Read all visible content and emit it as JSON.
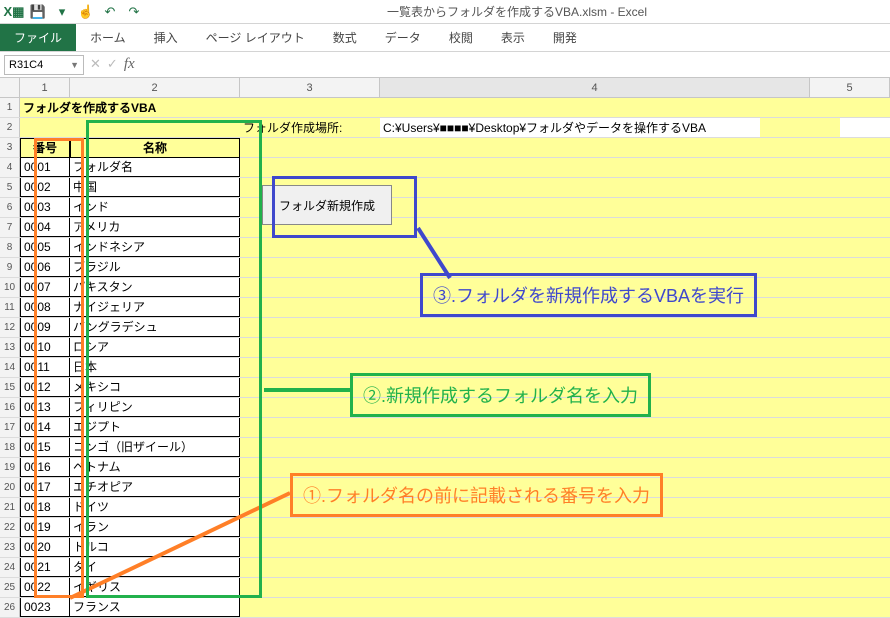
{
  "title": "一覧表からフォルダを作成するVBA.xlsm - Excel",
  "qat": {
    "excel": "X▦",
    "save": "💾",
    "dropdown": "▾",
    "touch": "☝",
    "undo": "↶",
    "redo": "↷"
  },
  "tabs": {
    "file": "ファイル",
    "home": "ホーム",
    "insert": "挿入",
    "pagelayout": "ページ レイアウト",
    "formulas": "数式",
    "data": "データ",
    "review": "校閲",
    "view": "表示",
    "developer": "開発"
  },
  "namebox": "R31C4",
  "fx_label": "fx",
  "columns": [
    "1",
    "2",
    "3",
    "4",
    "5"
  ],
  "sheet": {
    "title_cell": "フォルダを作成するVBA",
    "location_label": "フォルダ作成場所:",
    "location_value": "C:¥Users¥■■■■¥Desktop¥フォルダやデータを操作するVBA",
    "header": {
      "no": "番号",
      "name": "名称"
    },
    "rows": [
      {
        "no": "0001",
        "name": "フォルダ名"
      },
      {
        "no": "0002",
        "name": "中国"
      },
      {
        "no": "0003",
        "name": "インド"
      },
      {
        "no": "0004",
        "name": "アメリカ"
      },
      {
        "no": "0005",
        "name": "インドネシア"
      },
      {
        "no": "0006",
        "name": "ブラジル"
      },
      {
        "no": "0007",
        "name": "パキスタン"
      },
      {
        "no": "0008",
        "name": "ナイジェリア"
      },
      {
        "no": "0009",
        "name": "バングラデシュ"
      },
      {
        "no": "0010",
        "name": "ロシア"
      },
      {
        "no": "0011",
        "name": "日本"
      },
      {
        "no": "0012",
        "name": "メキシコ"
      },
      {
        "no": "0013",
        "name": "フィリピン"
      },
      {
        "no": "0014",
        "name": "エジプト"
      },
      {
        "no": "0015",
        "name": "コンゴ（旧ザイール）"
      },
      {
        "no": "0016",
        "name": "ベトナム"
      },
      {
        "no": "0017",
        "name": "エチオピア"
      },
      {
        "no": "0018",
        "name": "ドイツ"
      },
      {
        "no": "0019",
        "name": "イラン"
      },
      {
        "no": "0020",
        "name": "トルコ"
      },
      {
        "no": "0021",
        "name": "タイ"
      },
      {
        "no": "0022",
        "name": "イギリス"
      },
      {
        "no": "0023",
        "name": "フランス"
      }
    ]
  },
  "button": {
    "create": "フォルダ新規作成"
  },
  "annotations": {
    "step3": "③.フォルダを新規作成するVBAを実行",
    "step2": "②.新規作成するフォルダ名を入力",
    "step1": "①.フォルダ名の前に記載される番号を入力"
  }
}
